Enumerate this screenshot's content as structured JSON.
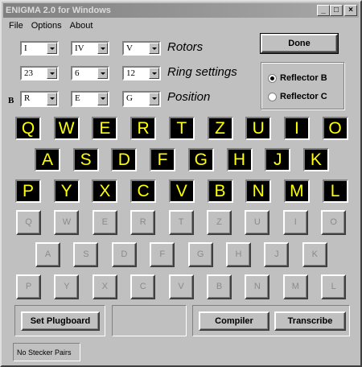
{
  "window": {
    "title": "ENIGMA 2.0 for Windows"
  },
  "titlebar_buttons": {
    "minimize": "_",
    "maximize": "□",
    "close": "×"
  },
  "menu": [
    "File",
    "Options",
    "About"
  ],
  "rotors": {
    "label": "Rotors",
    "values": [
      "I",
      "IV",
      "V"
    ]
  },
  "ring_settings": {
    "label": "Ring settings",
    "values": [
      "23",
      "6",
      "12"
    ]
  },
  "position": {
    "label": "Position",
    "prefix": "B",
    "values": [
      "R",
      "E",
      "G"
    ]
  },
  "done_label": "Done",
  "reflector": {
    "options": [
      {
        "label": "Reflector B",
        "selected": true
      },
      {
        "label": "Reflector C",
        "selected": false
      }
    ]
  },
  "lampboard": {
    "rows": [
      [
        "Q",
        "W",
        "E",
        "R",
        "T",
        "Z",
        "U",
        "I",
        "O"
      ],
      [
        "A",
        "S",
        "D",
        "F",
        "G",
        "H",
        "J",
        "K"
      ],
      [
        "P",
        "Y",
        "X",
        "C",
        "V",
        "B",
        "N",
        "M",
        "L"
      ]
    ]
  },
  "keyboard": {
    "rows": [
      [
        "Q",
        "W",
        "E",
        "R",
        "T",
        "Z",
        "U",
        "I",
        "O"
      ],
      [
        "A",
        "S",
        "D",
        "F",
        "G",
        "H",
        "J",
        "K"
      ],
      [
        "P",
        "Y",
        "X",
        "C",
        "V",
        "B",
        "N",
        "M",
        "L"
      ]
    ]
  },
  "buttons": {
    "plugboard": "Set Plugboard",
    "compiler": "Compiler",
    "transcribe": "Transcribe"
  },
  "status": "No Stecker Pairs"
}
